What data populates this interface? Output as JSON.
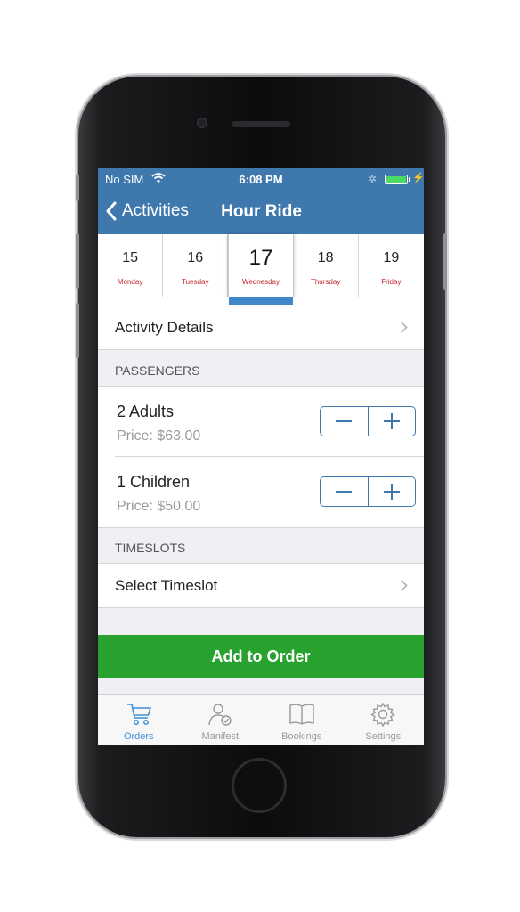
{
  "status_bar": {
    "carrier": "No SIM",
    "time": "6:08 PM"
  },
  "nav": {
    "back_label": "Activities",
    "title": "Hour Ride"
  },
  "dates": [
    {
      "num": "15",
      "day": "Monday"
    },
    {
      "num": "16",
      "day": "Tuesday"
    },
    {
      "num": "17",
      "day": "Wednesday",
      "selected": true
    },
    {
      "num": "18",
      "day": "Thursday"
    },
    {
      "num": "19",
      "day": "Friday"
    }
  ],
  "activity_details": {
    "label": "Activity Details"
  },
  "passengers": {
    "header": "PASSENGERS",
    "items": [
      {
        "name": "2  Adults",
        "price": "Price:  $63.00"
      },
      {
        "name": "1  Children",
        "price": "Price:  $50.00"
      }
    ]
  },
  "timeslots": {
    "header": "TIMESLOTS",
    "select_label": "Select Timeslot"
  },
  "add_to_order": {
    "label": "Add to Order"
  },
  "tabs": [
    {
      "label": "Orders",
      "icon": "cart-icon",
      "active": true
    },
    {
      "label": "Manifest",
      "icon": "person-check-icon"
    },
    {
      "label": "Bookings",
      "icon": "book-icon"
    },
    {
      "label": "Settings",
      "icon": "gear-icon"
    }
  ],
  "colors": {
    "nav": "#3e78ad",
    "accent": "#3e88c9",
    "cta": "#27a22f",
    "day_label": "#c1272d"
  }
}
